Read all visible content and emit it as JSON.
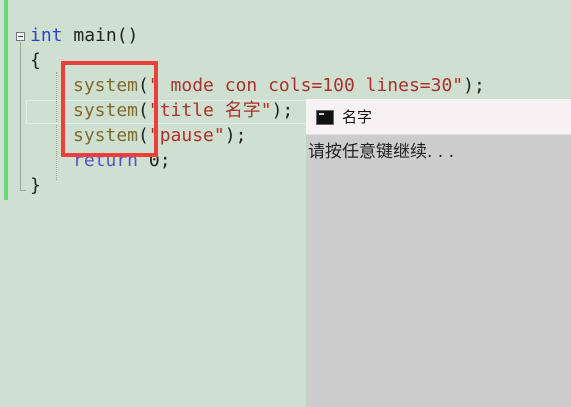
{
  "editor": {
    "line1": {
      "keyword": "int",
      "rest": " main()"
    },
    "line2": "{",
    "line3": {
      "fn": "system",
      "open": "(",
      "str": "\" mode con cols=100 lines=30\"",
      "close": ");"
    },
    "line4": {
      "fn": "system",
      "open": "(",
      "str": "\"title 名字\"",
      "close": ");"
    },
    "line5": {
      "fn": "system",
      "open": "(",
      "str": "\"pause\"",
      "close": ");"
    },
    "line6": {
      "keyword": "return",
      "rest": " 0;"
    },
    "line7": "}"
  },
  "console": {
    "title": "名字",
    "output": "请按任意键继续. . ."
  },
  "colors": {
    "editor_bg": "#cfe0d1",
    "keyword": "#2f3fd8",
    "function": "#7f6a2a",
    "string": "#a8322e",
    "highlight_box": "#e8403a",
    "console_bg": "#cdcdcd",
    "console_title_bg": "#f8f2f4"
  },
  "icons": {
    "fold": "collapse-minus-icon",
    "console": "console-window-icon"
  }
}
